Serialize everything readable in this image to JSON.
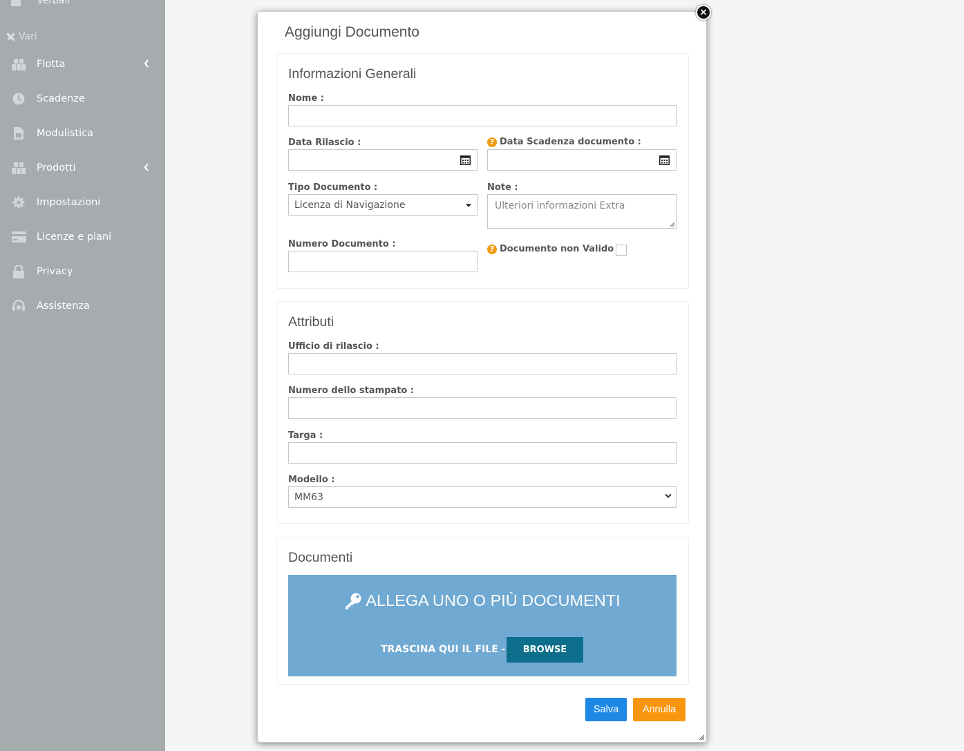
{
  "sidebar": {
    "top_item": "Verbali",
    "section": "Vari",
    "items": [
      {
        "label": "Flotta",
        "icon": "cubes-icon",
        "has_submenu": true
      },
      {
        "label": "Scadenze",
        "icon": "clock-icon",
        "has_submenu": false
      },
      {
        "label": "Modulistica",
        "icon": "file-icon",
        "has_submenu": false
      },
      {
        "label": "Prodotti",
        "icon": "cubes-icon",
        "has_submenu": true
      },
      {
        "label": "Impostazioni",
        "icon": "gear-icon",
        "has_submenu": false
      },
      {
        "label": "Licenze e piani",
        "icon": "credit-card-icon",
        "has_submenu": false
      },
      {
        "label": "Privacy",
        "icon": "lock-icon",
        "has_submenu": false
      },
      {
        "label": "Assistenza",
        "icon": "headset-icon",
        "has_submenu": false
      }
    ]
  },
  "modal": {
    "title": "Aggiungi Documento",
    "general": {
      "title": "Informazioni Generali",
      "nome_label": "Nome :",
      "nome_value": "",
      "data_rilascio_label": "Data Rilascio :",
      "data_rilascio_value": "",
      "data_scadenza_label": "Data Scadenza documento :",
      "data_scadenza_value": "",
      "tipo_label": "Tipo Documento :",
      "tipo_value": "Licenza di Navigazione",
      "note_label": "Note :",
      "note_placeholder": "Ulteriori informazioni Extra",
      "numero_label": "Numero Documento :",
      "numero_value": "",
      "non_valido_label": "Documento non Valido :",
      "non_valido_checked": false
    },
    "attributes": {
      "title": "Attributi",
      "ufficio_label": "Ufficio di rilascio :",
      "ufficio_value": "",
      "stampato_label": "Numero dello stampato :",
      "stampato_value": "",
      "targa_label": "Targa :",
      "targa_value": "",
      "modello_label": "Modello :",
      "modello_value": "MM63"
    },
    "documents": {
      "title": "Documenti",
      "dropzone_title": "ALLEGA UNO O PIÙ DOCUMENTI",
      "dropzone_sub": "TRASCINA QUI IL FILE -",
      "browse_label": "BROWSE"
    },
    "save_label": "Salva",
    "cancel_label": "Annulla",
    "close_label": "×"
  },
  "colors": {
    "sidebar_bg": "#a6abae",
    "dropzone_bg": "#70a9d1",
    "browse_bg": "#0e6f8c",
    "save_bg": "#1e88e5",
    "cancel_bg": "#f9960f",
    "help_icon": "#f39c12"
  }
}
